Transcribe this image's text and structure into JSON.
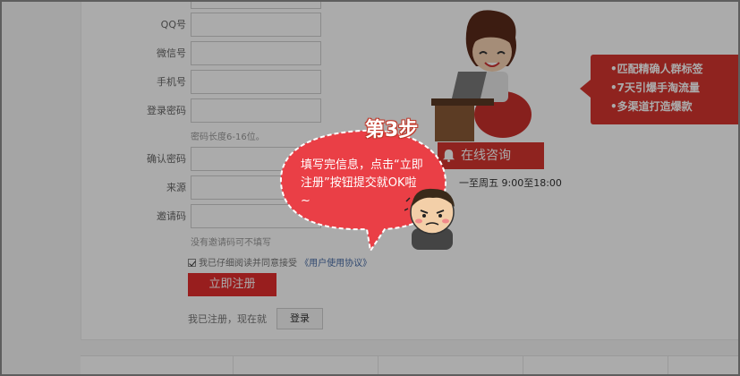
{
  "form": {
    "fields": [
      {
        "label": "QQ号",
        "value": ""
      },
      {
        "label": "微信号",
        "value": ""
      },
      {
        "label": "手机号",
        "value": ""
      },
      {
        "label": "登录密码",
        "value": ""
      },
      {
        "label": "确认密码",
        "value": ""
      },
      {
        "label": "来源",
        "value": ""
      },
      {
        "label": "邀请码",
        "value": ""
      }
    ],
    "password_hint": "密码长度6-16位。",
    "invite_hint": "没有邀请码可不填写",
    "agree_text": "我已仔细阅读并同意接受",
    "agree_link": "《用户使用协议》",
    "register_label": "立即注册",
    "already_text": "我已注册，现在就",
    "login_label": "登录"
  },
  "promo": {
    "tags": [
      "•匹配精确人群标签",
      "•7天引爆手淘流量",
      "•多渠道打造爆款"
    ],
    "consult_label": "在线咨询",
    "hours": "一至周五 9:00至18:00"
  },
  "tutorial": {
    "step_label": "第3步",
    "bubble_text": "填写完信息，点击“立即注册”按钮提交就OK啦~"
  },
  "colors": {
    "accent": "#e32d2d",
    "overlay": "rgba(0,0,0,0.33)"
  }
}
